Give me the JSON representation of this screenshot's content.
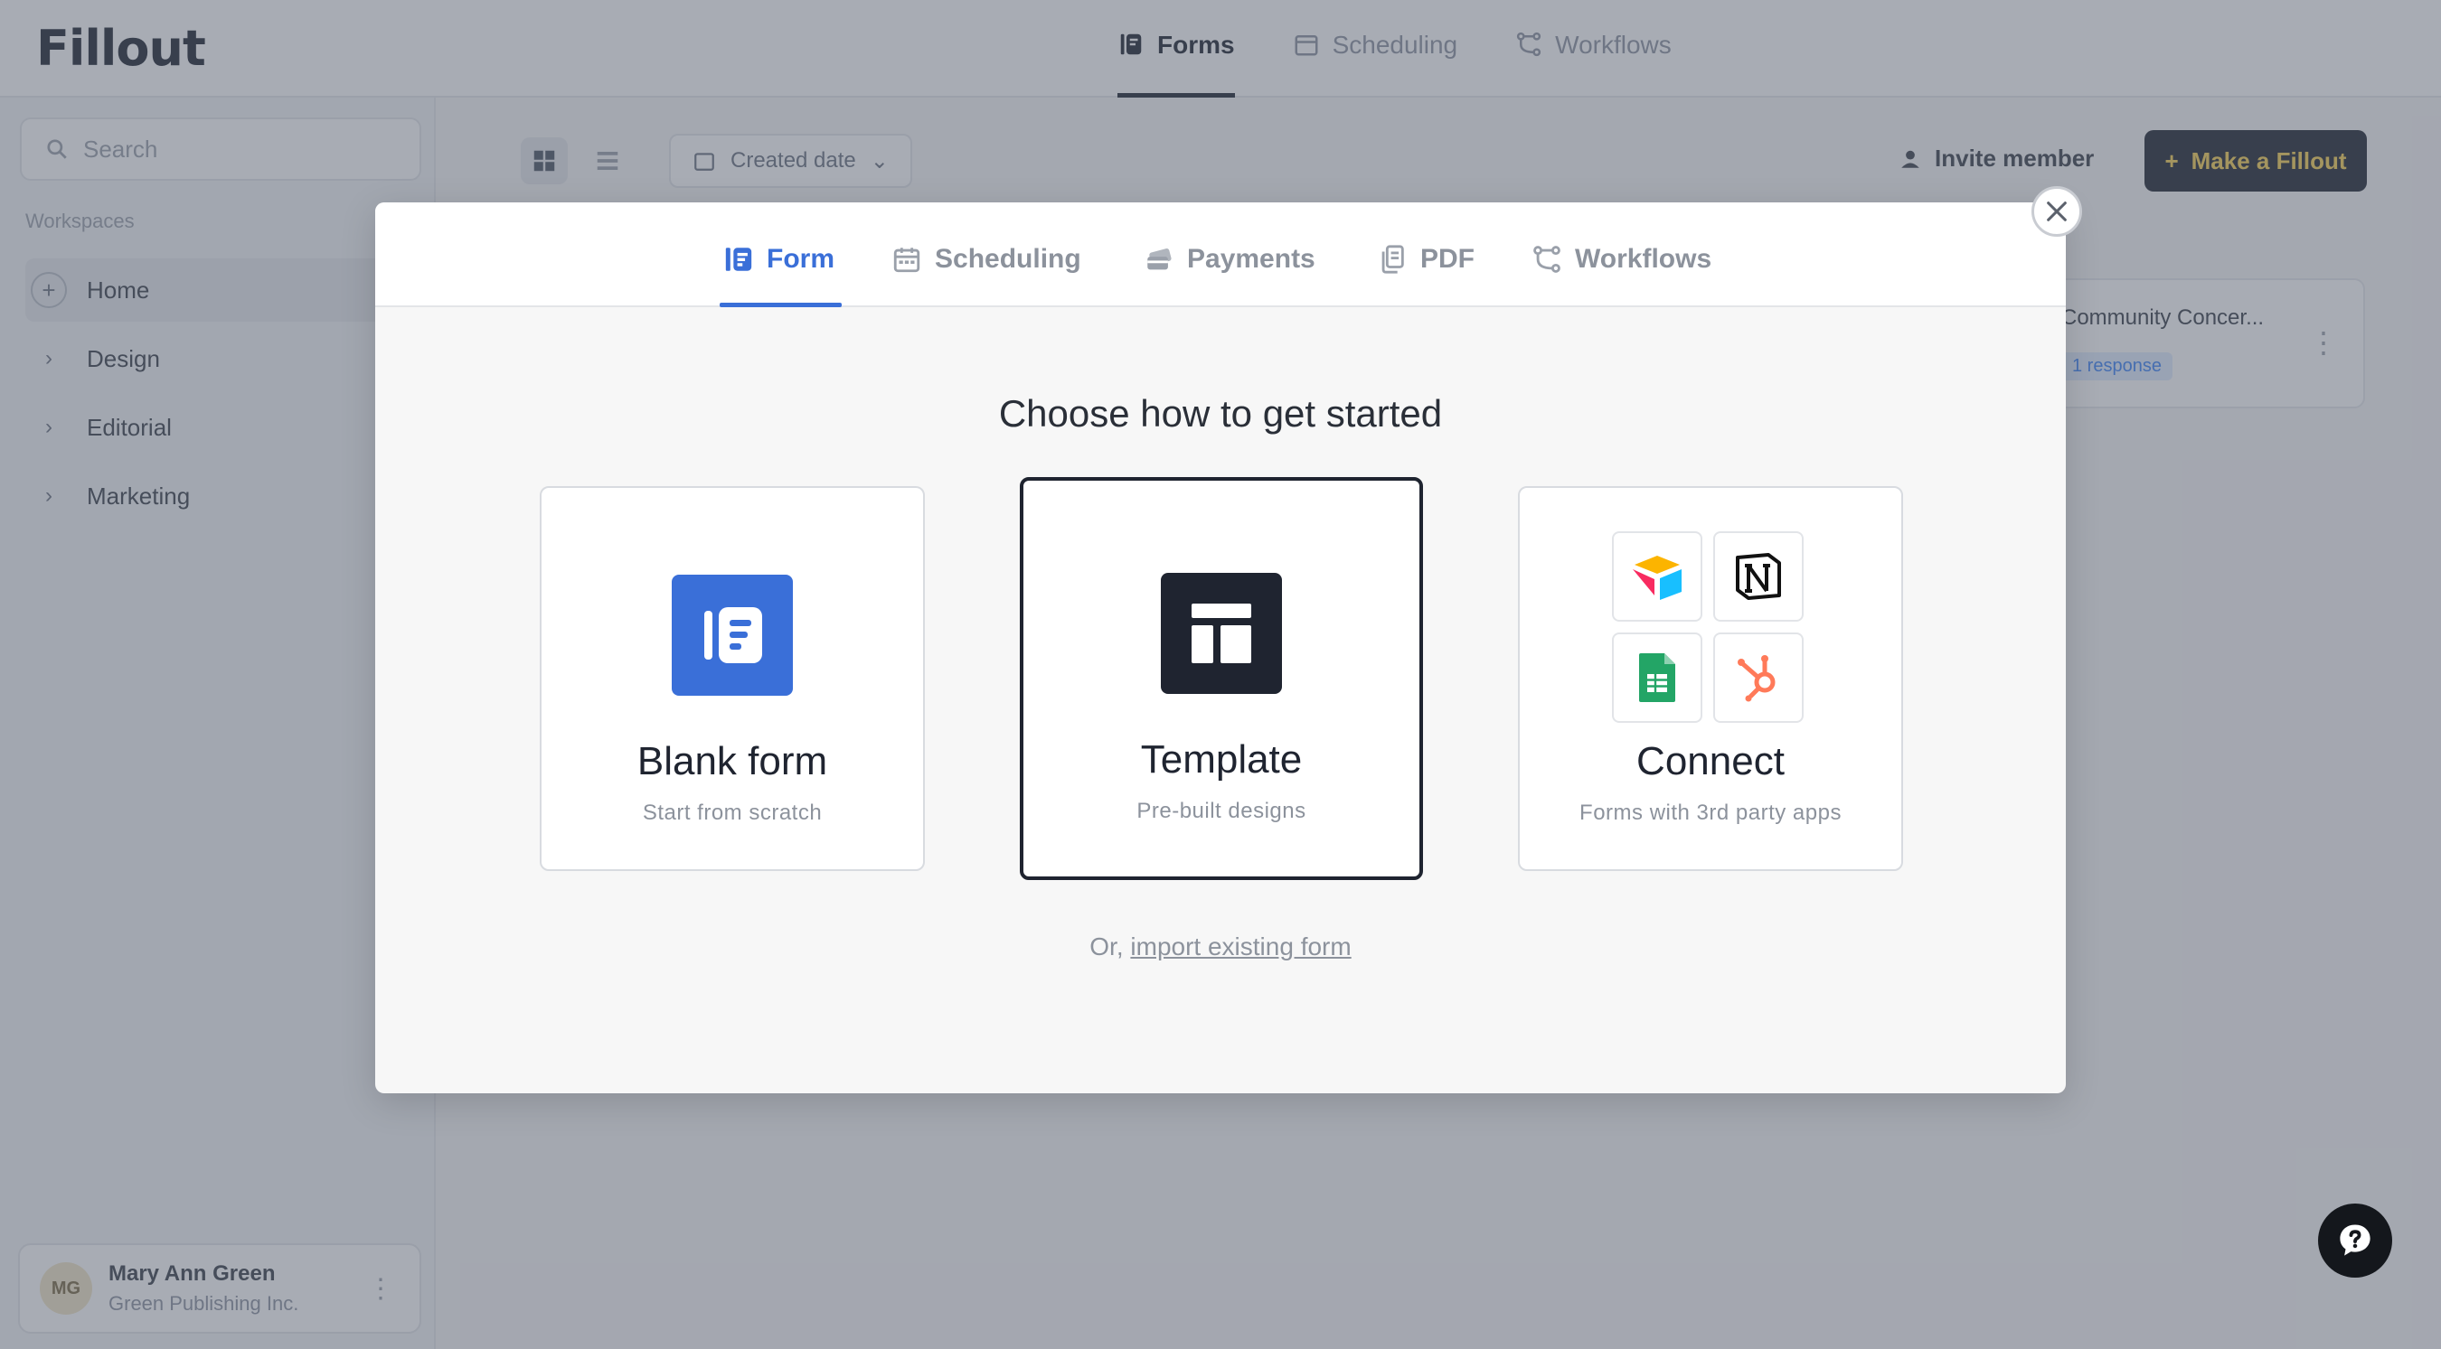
{
  "app": {
    "logo": "Fillout",
    "nav": [
      {
        "label": "Forms",
        "icon": "form-icon",
        "active": true
      },
      {
        "label": "Scheduling",
        "icon": "calendar-icon",
        "active": false
      },
      {
        "label": "Workflows",
        "icon": "workflow-icon",
        "active": false
      }
    ],
    "search_placeholder": "Search",
    "workspaces_title": "Workspaces",
    "workspaces": [
      {
        "label": "Home",
        "active": true
      },
      {
        "label": "Design",
        "active": false
      },
      {
        "label": "Editorial",
        "active": false
      },
      {
        "label": "Marketing",
        "active": false
      }
    ],
    "sort_label": "Created date",
    "invite_label": "Invite member",
    "make_button": "Make a Fillout",
    "form_card": {
      "title": "Community Concer...",
      "responses": "1 response"
    },
    "user": {
      "initials": "MG",
      "name": "Mary Ann Green",
      "org": "Green Publishing Inc."
    }
  },
  "modal": {
    "tabs": [
      {
        "label": "Form",
        "icon": "form-icon",
        "active": true
      },
      {
        "label": "Scheduling",
        "icon": "calendar-icon",
        "active": false
      },
      {
        "label": "Payments",
        "icon": "payments-icon",
        "active": false
      },
      {
        "label": "PDF",
        "icon": "pdf-icon",
        "active": false
      },
      {
        "label": "Workflows",
        "icon": "workflow-icon",
        "active": false
      }
    ],
    "heading": "Choose how to get started",
    "options": [
      {
        "title": "Blank form",
        "subtitle": "Start from scratch",
        "icon": "blank-form-icon",
        "selected": false
      },
      {
        "title": "Template",
        "subtitle": "Pre-built designs",
        "icon": "template-icon",
        "selected": true
      },
      {
        "title": "Connect",
        "subtitle": "Forms with 3rd party apps",
        "icon": "integrations-icon",
        "selected": false
      }
    ],
    "connect_apps": [
      "airtable-icon",
      "notion-icon",
      "google-sheets-icon",
      "hubspot-icon"
    ],
    "import_prefix": "Or,",
    "import_link": "import existing form"
  },
  "colors": {
    "accent": "#3a6fd8",
    "dark": "#1f2430",
    "brand_yellow": "#f7d154"
  }
}
